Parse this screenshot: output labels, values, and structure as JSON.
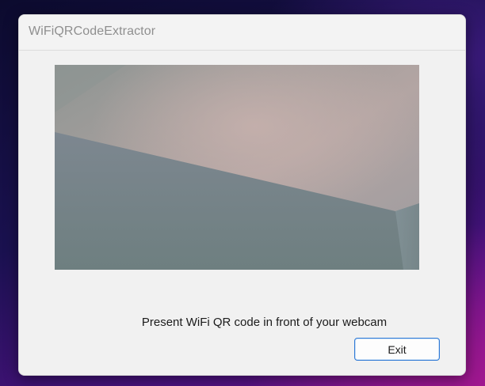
{
  "window": {
    "title": "WiFiQRCodeExtractor"
  },
  "main": {
    "webcam_feed": "live camera preview",
    "instruction": "Present WiFi QR code in front of your webcam",
    "exit_label": "Exit"
  },
  "colors": {
    "accent_border": "#2f7ad6",
    "window_bg": "#f1f1f1"
  }
}
